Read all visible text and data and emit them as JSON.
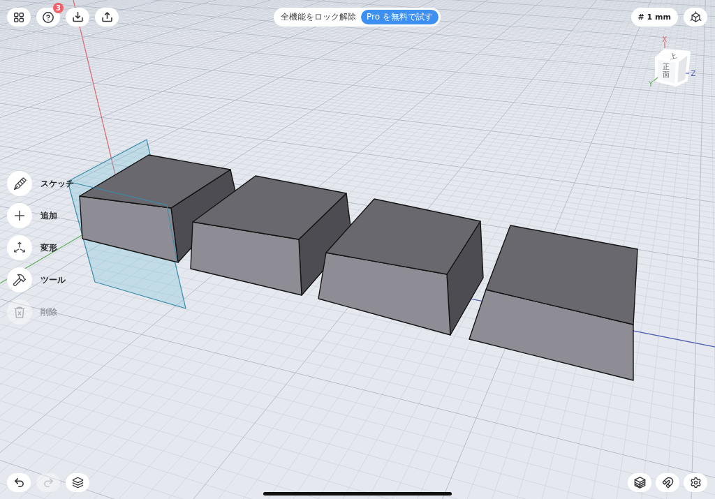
{
  "top_bar": {
    "left_buttons": [
      {
        "kind": "apps"
      },
      {
        "kind": "help",
        "badge": "3"
      },
      {
        "kind": "import"
      },
      {
        "kind": "export"
      }
    ],
    "unlock_text": "全機能をロック解除",
    "pro_button": "Pro を無料で試す",
    "grid_size": "# 1 mm",
    "right_buttons": [
      {
        "kind": "view"
      }
    ]
  },
  "view_cube": {
    "faces": [
      {
        "kind": "top",
        "label": "上"
      },
      {
        "kind": "front",
        "label": "正面"
      }
    ],
    "axes": [
      {
        "label": "X",
        "color": "#d86a74"
      },
      {
        "label": "Y",
        "color": "#63ad5e"
      },
      {
        "label": "Z",
        "color": "#4d5bb5"
      }
    ]
  },
  "tools": [
    {
      "kind": "sketch",
      "label": "スケッチ",
      "disabled": false
    },
    {
      "kind": "add",
      "label": "追加",
      "disabled": false
    },
    {
      "kind": "transform",
      "label": "変形",
      "disabled": false
    },
    {
      "kind": "tool",
      "label": "ツール",
      "disabled": false
    },
    {
      "kind": "delete",
      "label": "削除",
      "disabled": true
    }
  ],
  "bottom_left": [
    {
      "kind": "undo",
      "disabled": false
    },
    {
      "kind": "redo",
      "disabled": true
    },
    {
      "kind": "layers",
      "disabled": false
    }
  ],
  "bottom_right": [
    {
      "kind": "section"
    },
    {
      "kind": "snap"
    },
    {
      "kind": "settings"
    }
  ]
}
